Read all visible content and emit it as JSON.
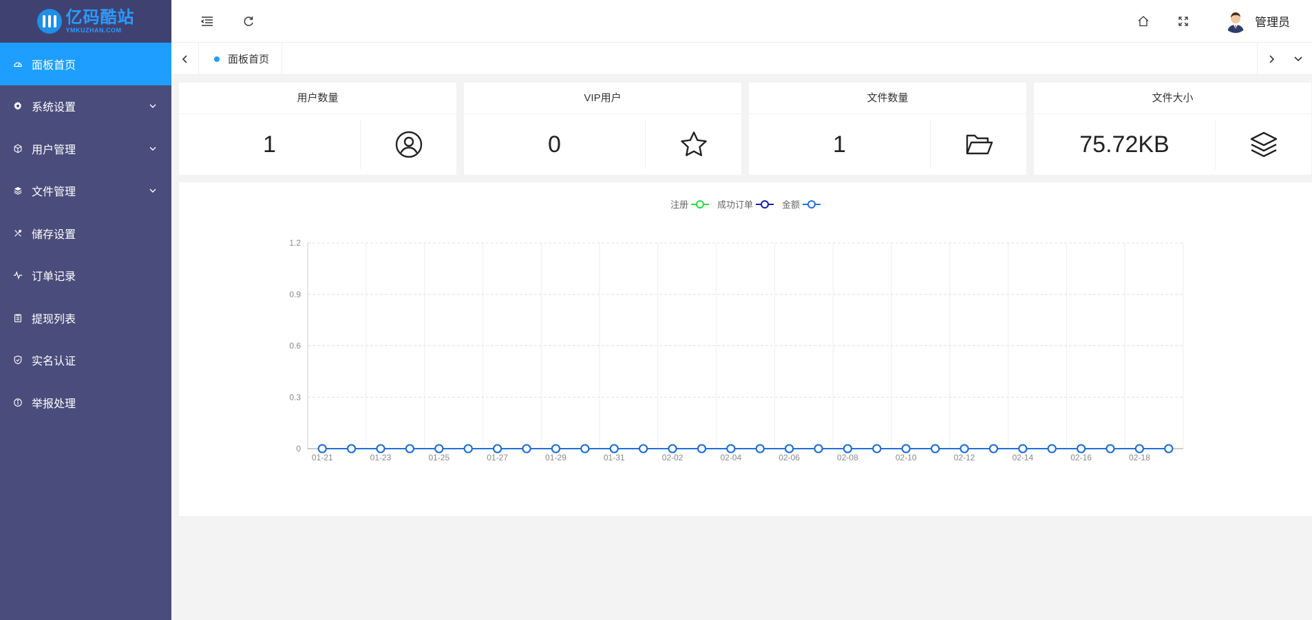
{
  "logo": {
    "main": "亿码酷站",
    "sub": "YMKUZHAN.COM"
  },
  "sidebar": {
    "items": [
      {
        "label": "面板首页",
        "icon": "dashboard-icon",
        "active": true,
        "expandable": false
      },
      {
        "label": "系统设置",
        "icon": "gear-icon",
        "active": false,
        "expandable": true
      },
      {
        "label": "用户管理",
        "icon": "cube-icon",
        "active": false,
        "expandable": true
      },
      {
        "label": "文件管理",
        "icon": "layers-icon",
        "active": false,
        "expandable": true
      },
      {
        "label": "储存设置",
        "icon": "tools-icon",
        "active": false,
        "expandable": false
      },
      {
        "label": "订单记录",
        "icon": "pulse-icon",
        "active": false,
        "expandable": false
      },
      {
        "label": "提现列表",
        "icon": "clipboard-icon",
        "active": false,
        "expandable": false
      },
      {
        "label": "实名认证",
        "icon": "shield-check-icon",
        "active": false,
        "expandable": false
      },
      {
        "label": "举报处理",
        "icon": "info-icon",
        "active": false,
        "expandable": false
      }
    ]
  },
  "header": {
    "user_name": "管理员"
  },
  "tabs": [
    {
      "label": "面板首页"
    }
  ],
  "stats": [
    {
      "title": "用户数量",
      "value": "1",
      "icon": "user-circle-icon"
    },
    {
      "title": "VIP用户",
      "value": "0",
      "icon": "star-icon"
    },
    {
      "title": "文件数量",
      "value": "1",
      "icon": "folder-open-icon"
    },
    {
      "title": "文件大小",
      "value": "75.72KB",
      "icon": "layers-icon"
    }
  ],
  "colors": {
    "sidebar_bg": "#4a4d7b",
    "active": "#1e9fff",
    "series_register": "#22dd44",
    "series_orders": "#1a1aa8",
    "series_amount": "#1e6fd6"
  },
  "chart_data": {
    "type": "line",
    "x": [
      "01-21",
      "01-22",
      "01-23",
      "01-24",
      "01-25",
      "01-26",
      "01-27",
      "01-28",
      "01-29",
      "01-30",
      "01-31",
      "02-01",
      "02-02",
      "02-03",
      "02-04",
      "02-05",
      "02-06",
      "02-07",
      "02-08",
      "02-09",
      "02-10",
      "02-11",
      "02-12",
      "02-13",
      "02-14",
      "02-15",
      "02-16",
      "02-17",
      "02-18",
      "02-19"
    ],
    "x_tick_labels": [
      "01-21",
      "01-23",
      "01-25",
      "01-27",
      "01-29",
      "01-31",
      "02-02",
      "02-04",
      "02-06",
      "02-08",
      "02-10",
      "02-12",
      "02-14",
      "02-16",
      "02-18"
    ],
    "y_ticks": [
      "0",
      "0.3",
      "0.6",
      "0.9",
      "1.2"
    ],
    "ylim": [
      0,
      1.2
    ],
    "grid": true,
    "legend_position": "top-center",
    "series": [
      {
        "name": "注册",
        "color": "#22dd44",
        "values": [
          0,
          0,
          0,
          0,
          0,
          0,
          0,
          0,
          0,
          0,
          0,
          0,
          0,
          0,
          0,
          0,
          0,
          0,
          0,
          0,
          0,
          0,
          0,
          0,
          0,
          0,
          0,
          0,
          0,
          0
        ]
      },
      {
        "name": "成功订单",
        "color": "#1a1aa8",
        "values": [
          0,
          0,
          0,
          0,
          0,
          0,
          0,
          0,
          0,
          0,
          0,
          0,
          0,
          0,
          0,
          0,
          0,
          0,
          0,
          0,
          0,
          0,
          0,
          0,
          0,
          0,
          0,
          0,
          0,
          0
        ]
      },
      {
        "name": "金额",
        "color": "#1e6fd6",
        "values": [
          0,
          0,
          0,
          0,
          0,
          0,
          0,
          0,
          0,
          0,
          0,
          0,
          0,
          0,
          0,
          0,
          0,
          0,
          0,
          0,
          0,
          0,
          0,
          0,
          0,
          0,
          0,
          0,
          0,
          0
        ]
      }
    ]
  }
}
